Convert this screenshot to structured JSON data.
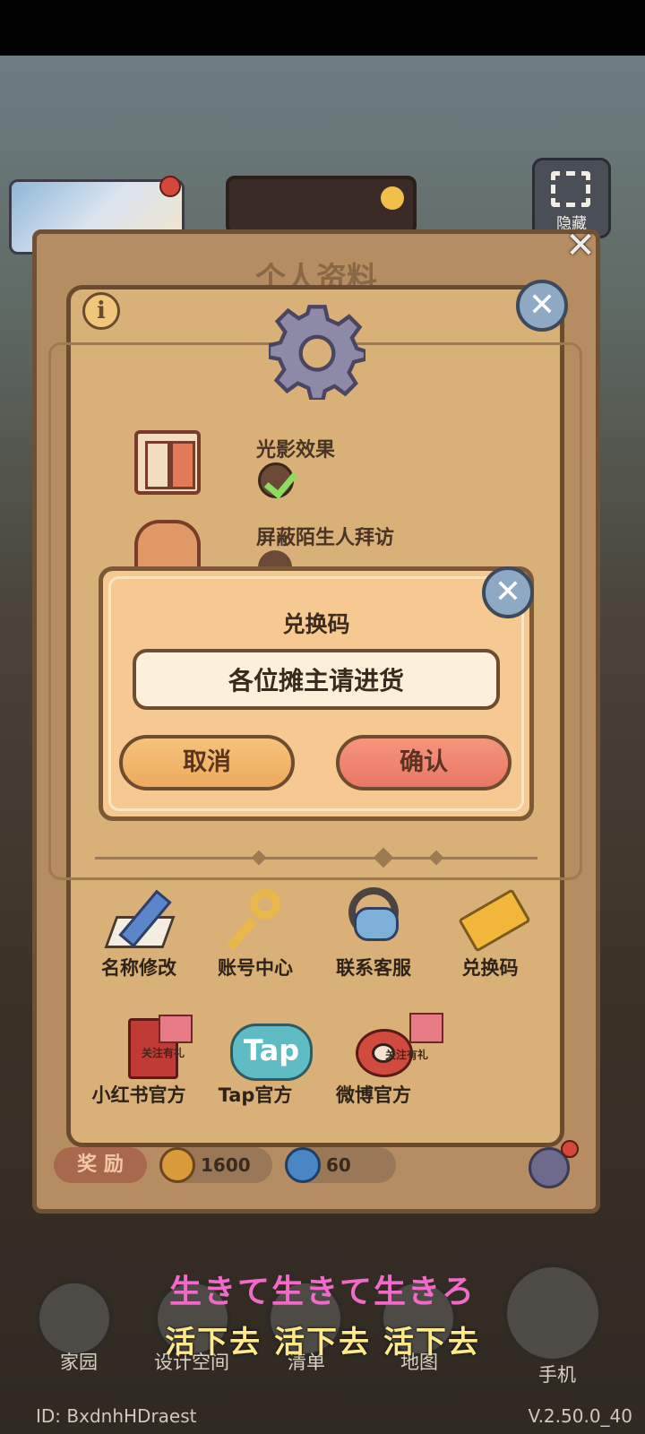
{
  "overlay": {
    "hide_label": "隐藏"
  },
  "profile_panel": {
    "title": "个人资料"
  },
  "settings": {
    "options": [
      {
        "label": "光影效果",
        "checked": true
      },
      {
        "label": "屏蔽陌生人拜访",
        "checked": false
      }
    ],
    "actions": [
      {
        "label": "名称修改",
        "icon": "pencil-icon"
      },
      {
        "label": "账号中心",
        "icon": "key-icon"
      },
      {
        "label": "联系客服",
        "icon": "headset-icon"
      },
      {
        "label": "兑换码",
        "icon": "ticket-icon"
      }
    ],
    "socials": [
      {
        "label": "小红书官方",
        "badge": "关注有礼"
      },
      {
        "label": "Tap官方",
        "logo": "Tap"
      },
      {
        "label": "微博官方",
        "badge": "关注有礼"
      }
    ]
  },
  "rewards": {
    "label": "奖 励",
    "coins": "1600",
    "gems": "60"
  },
  "redeem_dialog": {
    "title": "兑换码",
    "input_value": "各位摊主请进货",
    "cancel_label": "取消",
    "confirm_label": "确认"
  },
  "bottom_nav": {
    "items": [
      {
        "label": "家园"
      },
      {
        "label": "设计空间"
      },
      {
        "label": "清单"
      },
      {
        "label": "地图"
      },
      {
        "label": "手机"
      }
    ]
  },
  "subtitles": {
    "line1": "生きて生きて生きろ",
    "line2": "活下去 活下去 活下去"
  },
  "footer": {
    "player_id": "ID: BxdnhHDraest",
    "version": "V.2.50.0_40"
  },
  "colors": {
    "panel": "#d9b078",
    "dialog": "#f6c993",
    "confirm": "#ea7766",
    "cancel": "#eeab5d"
  }
}
